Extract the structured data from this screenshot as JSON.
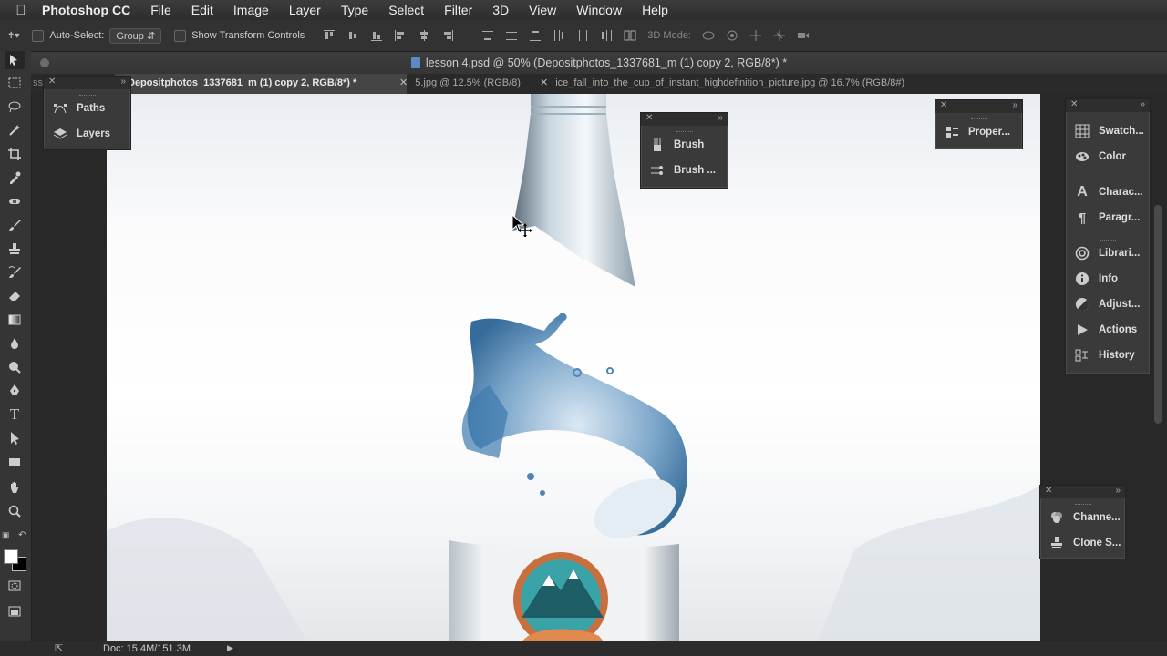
{
  "menubar": {
    "app_name": "Photoshop CC",
    "items": [
      "File",
      "Edit",
      "Image",
      "Layer",
      "Type",
      "Select",
      "Filter",
      "3D",
      "View",
      "Window",
      "Help"
    ]
  },
  "options_bar": {
    "auto_select_label": "Auto-Select:",
    "auto_select_value": "Group",
    "show_transform_label": "Show Transform Controls",
    "mode_3d_label": "3D Mode:"
  },
  "document": {
    "title": "lesson 4.psd @ 50% (Depositphotos_1337681_m (1) copy 2, RGB/8*) *"
  },
  "tabs": [
    {
      "label": "Depositphotos_1337681_m (1) copy 2, RGB/8*) *",
      "active": true
    },
    {
      "label": "5.jpg @ 12.5% (RGB/8)",
      "active": false
    },
    {
      "label": "ice_fall_into_the_cup_of_instant_highdefinition_picture.jpg @ 16.7% (RGB/8#)",
      "active": false
    }
  ],
  "tab_cut_prefix": "sse",
  "panels": {
    "left_dock": {
      "items": [
        {
          "label": "Paths",
          "icon": "paths-icon"
        },
        {
          "label": "Layers",
          "icon": "layers-icon"
        }
      ]
    },
    "brush_dock": {
      "items": [
        {
          "label": "Brush",
          "icon": "brush-icon"
        },
        {
          "label": "Brush ...",
          "icon": "brush-presets-icon"
        }
      ]
    },
    "properties_dock": {
      "items": [
        {
          "label": "Proper...",
          "icon": "properties-icon"
        }
      ]
    },
    "right_dock": {
      "groups": [
        [
          {
            "label": "Swatch...",
            "icon": "swatches-icon"
          },
          {
            "label": "Color",
            "icon": "color-icon"
          }
        ],
        [
          {
            "label": "Charac...",
            "icon": "character-icon"
          },
          {
            "label": "Paragr...",
            "icon": "paragraph-icon"
          }
        ],
        [
          {
            "label": "Librari...",
            "icon": "libraries-icon"
          },
          {
            "label": "Info",
            "icon": "info-icon"
          },
          {
            "label": "Adjust...",
            "icon": "adjustments-icon"
          },
          {
            "label": "Actions",
            "icon": "actions-icon"
          },
          {
            "label": "History",
            "icon": "history-icon"
          }
        ]
      ]
    },
    "channels_dock": {
      "items": [
        {
          "label": "Channe...",
          "icon": "channels-icon"
        },
        {
          "label": "Clone S...",
          "icon": "clone-source-icon"
        }
      ]
    }
  },
  "status": {
    "doc_size": "Doc: 15.4M/151.3M"
  },
  "colors": {
    "foreground": "#ffffff",
    "background": "#000000"
  }
}
